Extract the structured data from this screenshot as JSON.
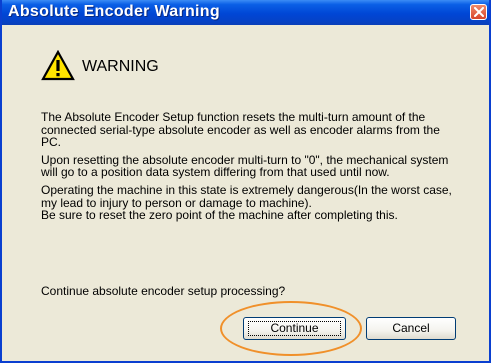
{
  "window": {
    "title": "Absolute Encoder Warning"
  },
  "warning": {
    "icon": "warning-triangle-icon",
    "title": "WARNING"
  },
  "body": {
    "para1": "The Absolute Encoder Setup function resets the multi-turn amount of the connected serial-type absolute encoder as well as encoder alarms from the PC.",
    "para2": "Upon resetting the absolute encoder multi-turn to \"0\", the mechanical system will go to a position data system differing from that used until now.",
    "para3": "Operating the machine in this state is extremely dangerous(In the worst case, my lead to injury to person or damage to machine).",
    "para4": "Be sure to reset the zero point of the machine after completing this."
  },
  "question": "Continue absolute encoder setup processing?",
  "buttons": {
    "continue_label": "Continue",
    "cancel_label": "Cancel"
  },
  "colors": {
    "titlebar": "#0046d5",
    "dialog_bg": "#ece9d8",
    "highlight": "#f0902a",
    "warning_yellow": "#ffe400"
  }
}
